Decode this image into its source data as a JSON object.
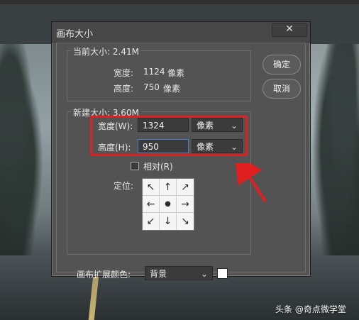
{
  "dialog": {
    "title": "画布大小",
    "close_label": "✕"
  },
  "current_size": {
    "legend": "当前大小: 2.41M",
    "width_label": "宽度:",
    "width_value": "1124",
    "width_unit": "像素",
    "height_label": "高度:",
    "height_value": "750",
    "height_unit": "像素"
  },
  "new_size": {
    "legend": "新建大小: 3.60M",
    "width_label": "宽度(W):",
    "width_value": "1324",
    "width_unit_selected": "像素",
    "height_label": "高度(H):",
    "height_value": "950",
    "height_unit_selected": "像素",
    "relative_label": "相对(R)",
    "relative_checked": false,
    "anchor_label": "定位:",
    "anchor_glyphs": [
      "↖",
      "↑",
      "↗",
      "←",
      "●",
      "→",
      "↙",
      "↓",
      "↘"
    ]
  },
  "buttons": {
    "ok": "确定",
    "cancel": "取消"
  },
  "extension": {
    "label": "画布扩展颜色:",
    "selected": "背景",
    "swatch_color": "#ffffff"
  },
  "annotation": {
    "color": "#e02020"
  },
  "watermark": {
    "text": "头条 @奇点微学堂"
  }
}
